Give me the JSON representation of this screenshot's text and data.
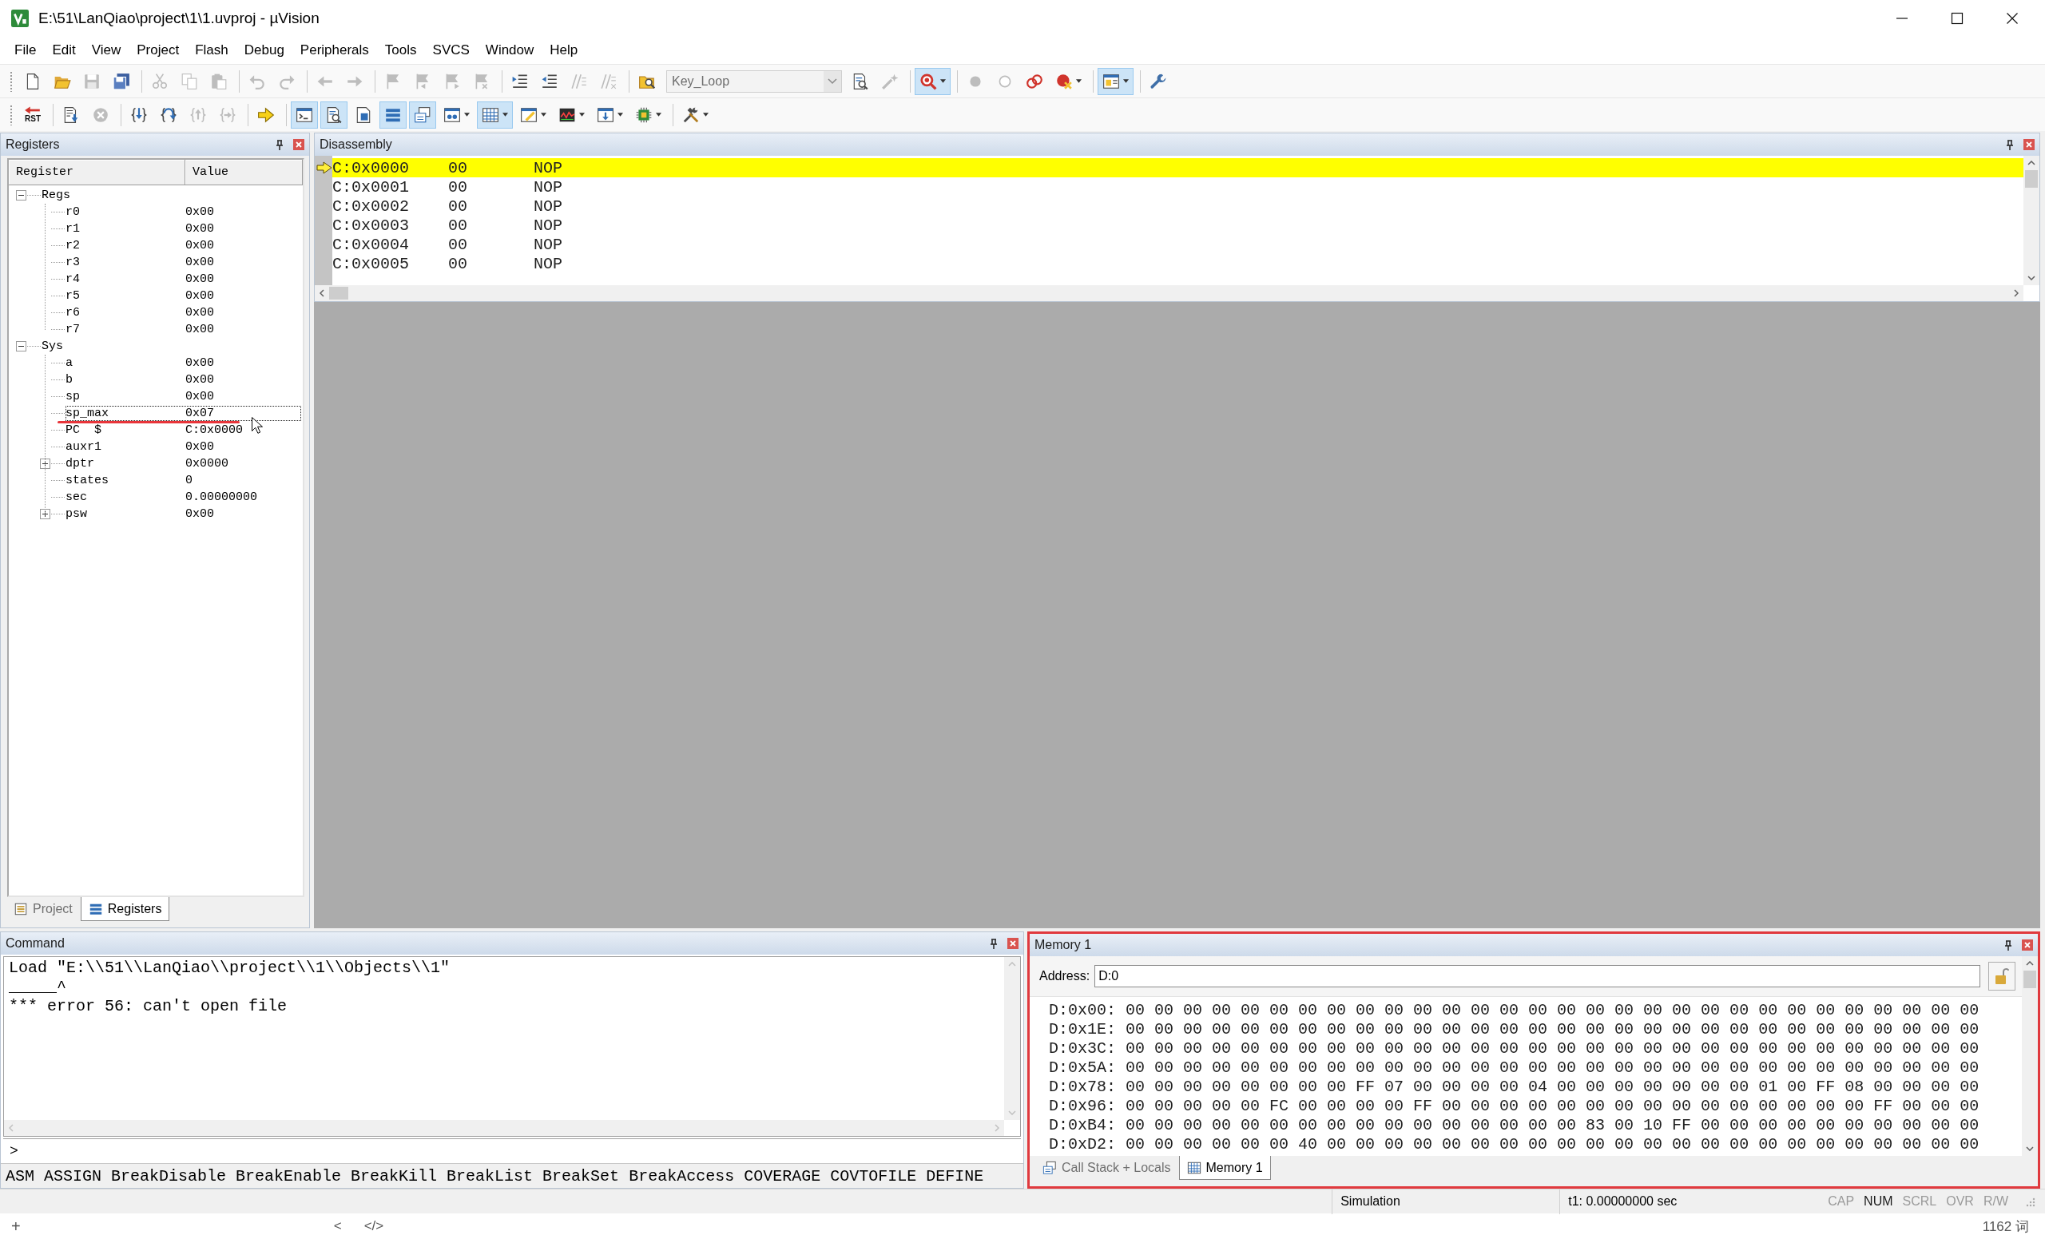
{
  "window": {
    "title": "E:\\51\\LanQiao\\project\\1\\1.uvproj - µVision"
  },
  "menu": [
    "File",
    "Edit",
    "View",
    "Project",
    "Flash",
    "Debug",
    "Peripherals",
    "Tools",
    "SVCS",
    "Window",
    "Help"
  ],
  "toolbars": [
    [
      {
        "kind": "new",
        "disabled": false,
        "on": false
      },
      {
        "kind": "open",
        "disabled": false,
        "on": false
      },
      {
        "kind": "save",
        "disabled": true,
        "on": false
      },
      {
        "kind": "save-all",
        "disabled": false,
        "on": false
      },
      {
        "kind": "separator"
      },
      {
        "kind": "cut",
        "disabled": true,
        "on": false
      },
      {
        "kind": "copy",
        "disabled": true,
        "on": false
      },
      {
        "kind": "paste",
        "disabled": true,
        "on": false
      },
      {
        "kind": "separator"
      },
      {
        "kind": "undo",
        "disabled": true,
        "on": false
      },
      {
        "kind": "redo",
        "disabled": true,
        "on": false
      },
      {
        "kind": "separator"
      },
      {
        "kind": "back",
        "disabled": true,
        "on": false
      },
      {
        "kind": "forward",
        "disabled": true,
        "on": false
      },
      {
        "kind": "separator"
      },
      {
        "kind": "bookmark",
        "disabled": true,
        "on": false
      },
      {
        "kind": "bookmark-prev",
        "disabled": true,
        "on": false
      },
      {
        "kind": "bookmark-next",
        "disabled": true,
        "on": false
      },
      {
        "kind": "bookmark-clear",
        "disabled": true,
        "on": false
      },
      {
        "kind": "separator"
      },
      {
        "kind": "indent",
        "disabled": false,
        "on": false
      },
      {
        "kind": "unindent",
        "disabled": false,
        "on": false
      },
      {
        "kind": "comment",
        "disabled": true,
        "on": false
      },
      {
        "kind": "uncomment",
        "disabled": true,
        "on": false
      },
      {
        "kind": "separator"
      },
      {
        "kind": "find-files",
        "disabled": false,
        "on": false
      },
      {
        "kind": "combo",
        "value": "Key_Loop",
        "disabled": true
      },
      {
        "kind": "find",
        "disabled": false,
        "on": false
      },
      {
        "kind": "wand",
        "disabled": true,
        "on": false
      },
      {
        "kind": "separator"
      },
      {
        "kind": "debug",
        "disabled": false,
        "on": true
      },
      {
        "kind": "separator"
      },
      {
        "kind": "bp-insert",
        "disabled": true,
        "on": false
      },
      {
        "kind": "bp-enable",
        "disabled": true,
        "on": false
      },
      {
        "kind": "bp-kill",
        "disabled": false,
        "on": false
      },
      {
        "kind": "bp-disable",
        "disabled": false,
        "on": false
      },
      {
        "kind": "separator"
      },
      {
        "kind": "layout",
        "disabled": false,
        "on": true
      },
      {
        "kind": "separator"
      },
      {
        "kind": "configure",
        "disabled": false,
        "on": false
      }
    ],
    [
      {
        "kind": "reset",
        "label": "RST",
        "disabled": false,
        "on": false
      },
      {
        "kind": "separator"
      },
      {
        "kind": "run",
        "disabled": false,
        "on": false
      },
      {
        "kind": "stop",
        "disabled": true,
        "on": false
      },
      {
        "kind": "separator"
      },
      {
        "kind": "step-into",
        "disabled": false,
        "on": false
      },
      {
        "kind": "step-over",
        "disabled": false,
        "on": false
      },
      {
        "kind": "step-out",
        "disabled": true,
        "on": false
      },
      {
        "kind": "run-to-cursor",
        "disabled": true,
        "on": false
      },
      {
        "kind": "separator"
      },
      {
        "kind": "show-next",
        "disabled": false,
        "on": false
      },
      {
        "kind": "separator"
      },
      {
        "kind": "command-window",
        "disabled": false,
        "on": true
      },
      {
        "kind": "disassembly",
        "disabled": false,
        "on": true
      },
      {
        "kind": "symbols",
        "disabled": false,
        "on": false
      },
      {
        "kind": "registers",
        "disabled": false,
        "on": true
      },
      {
        "kind": "call-stack",
        "disabled": false,
        "on": true
      },
      {
        "kind": "watch",
        "disabled": false,
        "on": false
      },
      {
        "kind": "memory",
        "disabled": false,
        "on": true
      },
      {
        "kind": "serial",
        "disabled": false,
        "on": false
      },
      {
        "kind": "analysis",
        "disabled": false,
        "on": false
      },
      {
        "kind": "trace",
        "disabled": false,
        "on": false
      },
      {
        "kind": "system-viewer",
        "disabled": false,
        "on": false
      },
      {
        "kind": "separator"
      },
      {
        "kind": "toolbox",
        "disabled": false,
        "on": false
      }
    ]
  ],
  "registers_panel": {
    "title": "Registers",
    "columns": [
      "Register",
      "Value"
    ],
    "tree": [
      {
        "name": "Regs",
        "expanded": true,
        "selected": false,
        "underlined": false,
        "children": [
          {
            "name": "r0",
            "value": "0x00",
            "selected": false,
            "underlined": false
          },
          {
            "name": "r1",
            "value": "0x00",
            "selected": false,
            "underlined": false
          },
          {
            "name": "r2",
            "value": "0x00",
            "selected": false,
            "underlined": false
          },
          {
            "name": "r3",
            "value": "0x00",
            "selected": false,
            "underlined": false
          },
          {
            "name": "r4",
            "value": "0x00",
            "selected": false,
            "underlined": false
          },
          {
            "name": "r5",
            "value": "0x00",
            "selected": false,
            "underlined": false
          },
          {
            "name": "r6",
            "value": "0x00",
            "selected": false,
            "underlined": false
          },
          {
            "name": "r7",
            "value": "0x00",
            "selected": false,
            "underlined": false
          }
        ]
      },
      {
        "name": "Sys",
        "expanded": true,
        "selected": false,
        "underlined": false,
        "children": [
          {
            "name": "a",
            "value": "0x00",
            "selected": false,
            "underlined": false
          },
          {
            "name": "b",
            "value": "0x00",
            "selected": false,
            "underlined": false
          },
          {
            "name": "sp",
            "value": "0x00",
            "selected": false,
            "underlined": false
          },
          {
            "name": "sp_max",
            "value": "0x07",
            "selected": true,
            "underlined": true
          },
          {
            "name": "PC  $",
            "value": "C:0x0000",
            "selected": false,
            "underlined": false
          },
          {
            "name": "auxr1",
            "value": "0x00",
            "selected": false,
            "underlined": false
          },
          {
            "name": "dptr",
            "value": "0x0000",
            "expanded": false,
            "selected": false,
            "underlined": false
          },
          {
            "name": "states",
            "value": "0",
            "selected": false,
            "underlined": false
          },
          {
            "name": "sec",
            "value": "0.00000000",
            "selected": false,
            "underlined": false
          },
          {
            "name": "psw",
            "value": "0x00",
            "expanded": false,
            "selected": false,
            "underlined": false
          }
        ]
      }
    ],
    "tabs": [
      {
        "label": "Project",
        "kind": "project",
        "selected": false
      },
      {
        "label": "Registers",
        "kind": "registers",
        "selected": true
      }
    ]
  },
  "disassembly_panel": {
    "title": "Disassembly",
    "rows": [
      {
        "address": "C:0x0000",
        "opcode": "00",
        "instruction": "NOP",
        "current": true
      },
      {
        "address": "C:0x0001",
        "opcode": "00",
        "instruction": "NOP",
        "current": false
      },
      {
        "address": "C:0x0002",
        "opcode": "00",
        "instruction": "NOP",
        "current": false
      },
      {
        "address": "C:0x0003",
        "opcode": "00",
        "instruction": "NOP",
        "current": false
      },
      {
        "address": "C:0x0004",
        "opcode": "00",
        "instruction": "NOP",
        "current": false
      },
      {
        "address": "C:0x0005",
        "opcode": "00",
        "instruction": "NOP",
        "current": false
      }
    ]
  },
  "command_panel": {
    "title": "Command",
    "output": [
      "Load \"E:\\\\51\\\\LanQiao\\\\project\\\\1\\\\Objects\\\\1\"",
      "_____^",
      "*** error 56: can't open file"
    ],
    "prompt": ">",
    "hints": "ASM ASSIGN BreakDisable BreakEnable BreakKill BreakList BreakSet BreakAccess COVERAGE COVTOFILE DEFINE"
  },
  "memory_panel": {
    "title": "Memory 1",
    "highlighted": true,
    "address_label": "Address:",
    "address": "D:0",
    "rows": [
      {
        "address": "D:0x00:",
        "bytes": "00 00 00 00 00 00 00 00 00 00 00 00 00 00 00 00 00 00 00 00 00 00 00 00 00 00 00 00 00 00"
      },
      {
        "address": "D:0x1E:",
        "bytes": "00 00 00 00 00 00 00 00 00 00 00 00 00 00 00 00 00 00 00 00 00 00 00 00 00 00 00 00 00 00"
      },
      {
        "address": "D:0x3C:",
        "bytes": "00 00 00 00 00 00 00 00 00 00 00 00 00 00 00 00 00 00 00 00 00 00 00 00 00 00 00 00 00 00"
      },
      {
        "address": "D:0x5A:",
        "bytes": "00 00 00 00 00 00 00 00 00 00 00 00 00 00 00 00 00 00 00 00 00 00 00 00 00 00 00 00 00 00"
      },
      {
        "address": "D:0x78:",
        "bytes": "00 00 00 00 00 00 00 00 FF 07 00 00 00 00 04 00 00 00 00 00 00 00 01 00 FF 08 00 00 00 00"
      },
      {
        "address": "D:0x96:",
        "bytes": "00 00 00 00 00 FC 00 00 00 00 FF 00 00 00 00 00 00 00 00 00 00 00 00 00 00 00 FF 00 00 00"
      },
      {
        "address": "D:0xB4:",
        "bytes": "00 00 00 00 00 00 00 00 00 00 00 00 00 00 00 00 83 00 10 FF 00 00 00 00 00 00 00 00 00 00"
      },
      {
        "address": "D:0xD2:",
        "bytes": "00 00 00 00 00 00 40 00 00 00 00 00 00 00 00 00 00 00 00 00 00 00 00 00 00 00 00 00 00 00"
      }
    ],
    "tabs": [
      {
        "label": "Call Stack + Locals",
        "kind": "call-stack",
        "selected": false
      },
      {
        "label": "Memory 1",
        "kind": "memory",
        "selected": true
      }
    ]
  },
  "status_bar": {
    "mode": "Simulation",
    "time": "t1: 0.00000000 sec",
    "indicators": [
      {
        "label": "CAP",
        "on": false
      },
      {
        "label": "NUM",
        "on": true
      },
      {
        "label": "SCRL",
        "on": false
      },
      {
        "label": "OVR",
        "on": false
      },
      {
        "label": "R/W",
        "on": false
      }
    ]
  },
  "bottom_bar": {
    "add": "+",
    "back": "<",
    "code": "</>",
    "word_count": "1162 词"
  }
}
